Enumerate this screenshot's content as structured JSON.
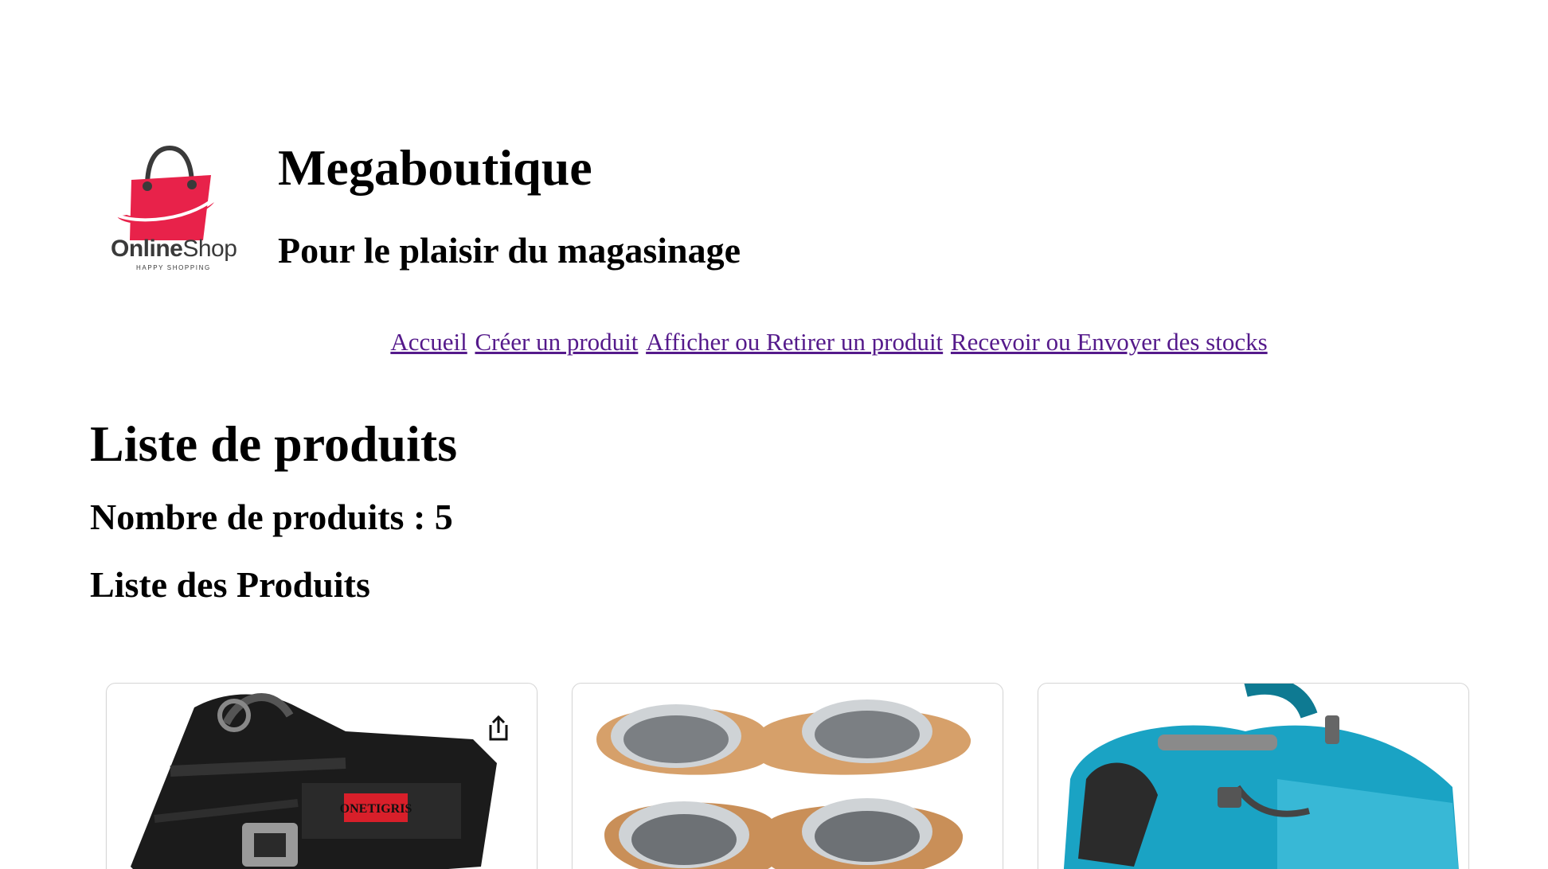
{
  "header": {
    "logo_brand_bold": "Online",
    "logo_brand_light": "Shop",
    "logo_tagline": "HAPPY SHOPPING",
    "title": "Megaboutique",
    "subtitle": "Pour le plaisir du magasinage"
  },
  "nav": {
    "items": [
      {
        "label": "Accueil"
      },
      {
        "label": "Créer un produit"
      },
      {
        "label": "Afficher ou Retirer un produit"
      },
      {
        "label": "Recevoir ou Envoyer des stocks"
      }
    ]
  },
  "main": {
    "heading": "Liste de produits",
    "count_label": "Nombre de produits : 5",
    "list_heading": "Liste des Produits"
  },
  "cards": [
    {
      "image": "tactical-dog-harness",
      "patch_text": "ONETIGRIS",
      "icon": "share-icon"
    },
    {
      "image": "double-dog-bowls"
    },
    {
      "image": "dog-backpack-harness"
    }
  ],
  "colors": {
    "link": "#551a8b",
    "logo_bag": "#e8224a",
    "logo_text": "#3a3a3a",
    "backpack": "#1aa3c4"
  }
}
